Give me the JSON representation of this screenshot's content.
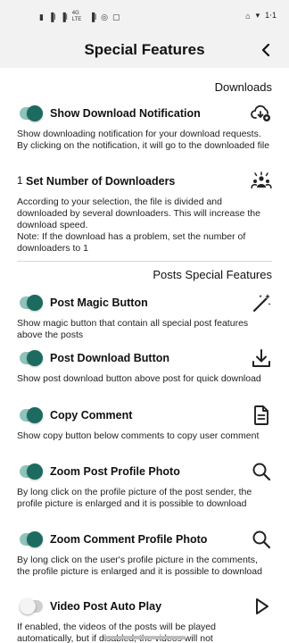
{
  "header": {
    "title": "Special Features"
  },
  "sections": {
    "downloads": "Downloads",
    "posts": "Posts Special Features"
  },
  "status_bar": {
    "left_glyphs": [
      "▮",
      "▐l",
      "▐l",
      "4G LTE",
      "▐l",
      "◎",
      "▢"
    ],
    "right_glyphs": [
      "⌂",
      "▾",
      "1⋅1"
    ]
  },
  "settings": [
    {
      "label": "Show Download Notification",
      "enabled": true,
      "icon": "cloud-download-settings-icon",
      "description": "Show downloading notification for your download requests. By clicking on the notification, it will go to the downloaded file"
    },
    {
      "count": "1",
      "label": "Set Number of Downloaders",
      "icon": "people-group-icon",
      "description": "According to your selection, the file is divided and downloaded by several downloaders. This will increase the download speed.\nNote: If the download has a problem, set the number of downloaders to 1"
    },
    {
      "label": "Post Magic Button",
      "enabled": true,
      "icon": "magic-wand-icon",
      "description": "Show magic button that contain all special post features above the posts"
    },
    {
      "label": "Post Download Button",
      "enabled": true,
      "icon": "download-icon",
      "description": "Show post download button above post for quick download"
    },
    {
      "label": "Copy Comment",
      "enabled": true,
      "icon": "document-icon",
      "description": "Show copy button below comments to copy user comment"
    },
    {
      "label": "Zoom Post Profile Photo",
      "enabled": true,
      "icon": "search-icon",
      "description": "By long click on the profile picture of the post sender, the profile picture is enlarged and it is possible to download"
    },
    {
      "label": "Zoom Comment Profile Photo",
      "enabled": true,
      "icon": "search-icon",
      "description": "By long click on the user's profile picture in the comments, the profile picture is enlarged and it is possible to download"
    },
    {
      "label": "Video Post Auto Play",
      "enabled": false,
      "icon": "play-icon",
      "description": "If enabled, the videos of the posts will be played automatically, but if disabled, the videos will not"
    }
  ],
  "colors": {
    "toggle_on_track": "#8fc4bb",
    "toggle_on_knob": "#1d6b60",
    "toggle_off_track": "#cfcfcf",
    "header_bg": "#f2f2f2"
  }
}
